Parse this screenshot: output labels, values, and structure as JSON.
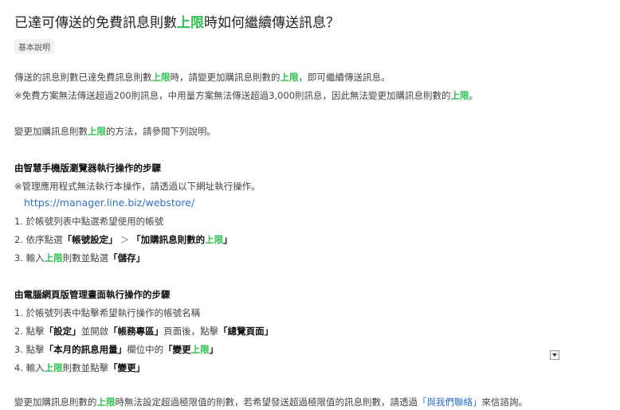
{
  "title": {
    "p1": "已達可傳送的免費訊息則數",
    "hl": "上限",
    "p2": "時如何繼續傳送訊息？"
  },
  "badge": "基本說明",
  "intro": {
    "l1": {
      "p1": "傳送的訊息則數已達免費訊息則數",
      "hl1": "上限",
      "p2": "時，請變更加購訊息則數的",
      "hl2": "上限",
      "p3": "，即可繼續傳送訊息。"
    },
    "l2": {
      "p1": "※免費方案無法傳送超過200則訊息，中用量方案無法傳送超過3,000則訊息，因此無法變更加購訊息則數的",
      "hl": "上限",
      "p2": "。"
    },
    "l3": {
      "p1": "變更加購訊息則數",
      "hl": "上限",
      "p2": "的方法，請參閱下列說明。"
    }
  },
  "mobile": {
    "heading": "由智慧手機版瀏覽器執行操作的步驟",
    "note": "※管理應用程式無法執行本操作，請透過以下網址執行操作。",
    "url": "https://manager.line.biz/webstore/",
    "s1": "1. 於帳號列表中點選希望使用的帳號",
    "s2": {
      "p1": "2. 依序點選",
      "b1": "「帳號設定」",
      "gt": "＞",
      "b2a": "「加購訊息則數的",
      "hl": "上限",
      "b2b": "」"
    },
    "s3": {
      "p1": "3. 輸入",
      "hl": "上限",
      "p2": "則數並點選",
      "b": "「儲存」"
    }
  },
  "pc": {
    "heading": "由電腦網頁版管理畫面執行操作的步驟",
    "s1": "1. 於帳號列表中點擊希望執行操作的帳號名稱",
    "s2": {
      "p1": "2. 點擊",
      "b1": "「設定」",
      "p2": "並開啟",
      "b2": "「帳務專區」",
      "p3": "頁面後，點擊",
      "b3": "「總覽頁面」"
    },
    "s3": {
      "p1": "3. 點擊",
      "b1": "「本月的訊息用量」",
      "p2": "欄位中的",
      "b2a": "「變更",
      "hl": "上限",
      "b2b": "」"
    },
    "s4": {
      "p1": "4. 輸入",
      "hl": "上限",
      "p2": "則數並點擊",
      "b": "「變更」"
    }
  },
  "footer": {
    "p1": "變更加購訊息則數的",
    "hl": "上限",
    "p2": "時無法設定超過極限值的則數，若希望發送超過極限值的訊息則數，請透過",
    "link": "「與我們聯絡」",
    "p3": "來信諮詢。"
  },
  "colors": {
    "highlight": "#2ec24f",
    "link": "#2f6fc4"
  },
  "icons": {
    "scroll": "chevron-down-icon"
  }
}
